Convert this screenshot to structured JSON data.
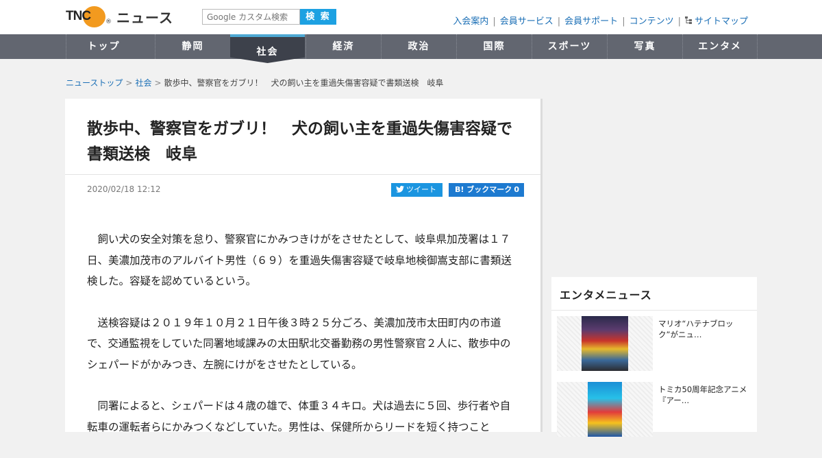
{
  "header": {
    "logo_text": "TNC",
    "logo_badge": "TNC",
    "site_name": "ニュース",
    "search_placeholder": "Google カスタム検索",
    "search_button": "検 索",
    "links": [
      "入会案内",
      "会員サービス",
      "会員サポート",
      "コンテンツ",
      "サイトマップ"
    ],
    "sitemap_icon": "sitemap-icon"
  },
  "nav": {
    "items": [
      "トップ",
      "静岡",
      "社会",
      "経済",
      "政治",
      "国際",
      "スポーツ",
      "写真",
      "エンタメ"
    ],
    "active": "社会"
  },
  "breadcrumb": {
    "items": [
      "ニューストップ",
      "社会",
      "散歩中、警察官をガブリ！　犬の飼い主を重過失傷害容疑で書類送検　岐阜"
    ],
    "separator": ">"
  },
  "article": {
    "title": "散歩中、警察官をガブリ！　犬の飼い主を重過失傷害容疑で書類送検　岐阜",
    "date": "2020/02/18 12:12",
    "tweet_label": "ツイート",
    "hatena_label": "B! ブックマーク",
    "hatena_count": "0",
    "paragraphs": [
      "　飼い犬の安全対策を怠り、警察官にかみつきけがをさせたとして、岐阜県加茂署は１７日、美濃加茂市のアルバイト男性（６９）を重過失傷害容疑で岐阜地検御嵩支部に書類送検した。容疑を認めているという。",
      "　送検容疑は２０１９年１０月２１日午後３時２５分ごろ、美濃加茂市太田町内の市道で、交通監視をしていた同署地域課みの太田駅北交番勤務の男性警察官２人に、散歩中のシェパードがかみつき、左腕にけがをさせたとしている。",
      "　同署によると、シェパードは４歳の雄で、体重３４キロ。犬は過去に５回、歩行者や自転車の運転者らにかみつくなどしていた。男性は、保健所からリードを短く持つこと"
    ]
  },
  "sidebar": {
    "title": "エンタメニュース",
    "items": [
      {
        "text": "マリオ“ハテナブロック”がニュ…"
      },
      {
        "text": "トミカ50周年記念アニメ『アー…"
      }
    ]
  },
  "colors": {
    "nav_bg": "#626670",
    "nav_active": "#3d414b",
    "accent_blue": "#1da1e2",
    "link": "#1b6fb6",
    "logo_orange": "#f29a1f"
  }
}
